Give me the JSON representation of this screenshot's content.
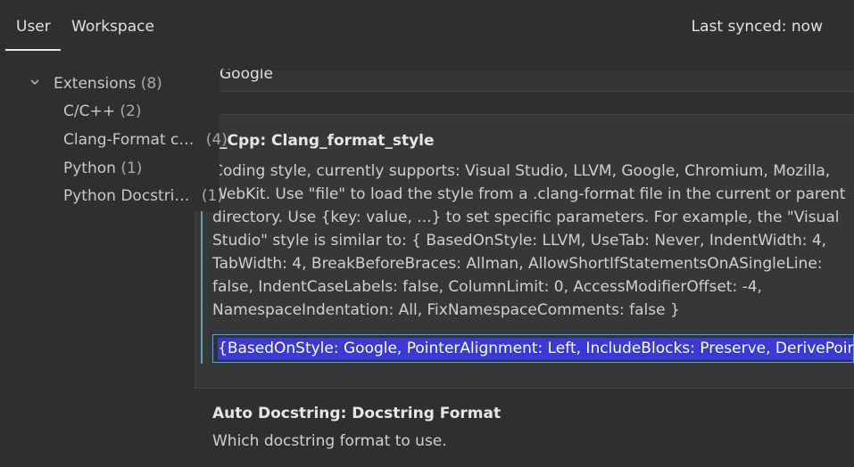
{
  "header": {
    "tabs": [
      {
        "label": "User"
      },
      {
        "label": "Workspace"
      }
    ],
    "last_synced": "Last synced: now"
  },
  "toc": {
    "group": {
      "label": "Extensions",
      "count": "(8)"
    },
    "items": [
      {
        "label": "C/C++",
        "count": "(2)"
      },
      {
        "label": "Clang-Format c…",
        "count": "(4)"
      },
      {
        "label": "Python",
        "count": "(1)"
      },
      {
        "label": "Python Docstri…",
        "count": "(1)"
      }
    ]
  },
  "content": {
    "previous_value": "Google",
    "setting": {
      "title": "_Cpp: Clang_format_style",
      "description_lines": [
        "Coding style, currently supports: Visual Studio, LLVM, Google, Chromium, Mozilla,",
        "WebKit. Use \"file\" to load the style from a .clang-format file in the current or parent",
        "directory. Use {key: value, ...} to set specific parameters. For example, the \"Visual",
        "Studio\" style is similar to: { BasedOnStyle: LLVM, UseTab: Never, IndentWidth: 4,",
        "TabWidth: 4, BreakBeforeBraces: Allman, AllowShortIfStatementsOnASingleLine:",
        "false, IndentCaseLabels: false, ColumnLimit: 0, AccessModifierOffset: -4,",
        "NamespaceIndentation: All, FixNamespaceComments: false }"
      ],
      "value": "{BasedOnStyle: Google, PointerAlignment: Left, IncludeBlocks: Preserve, DerivePointerAlignment: false}"
    },
    "next_setting": {
      "title": "Auto Docstring: Docstring Format",
      "description": "Which docstring format to use."
    }
  },
  "colors": {
    "background": "#2e2f2f",
    "focus_border": "#4aa6ff",
    "selection": "#3a38d6",
    "accent_bar": "#58a5b8"
  },
  "icons": {
    "group_toggle": "chevron-down-icon"
  }
}
